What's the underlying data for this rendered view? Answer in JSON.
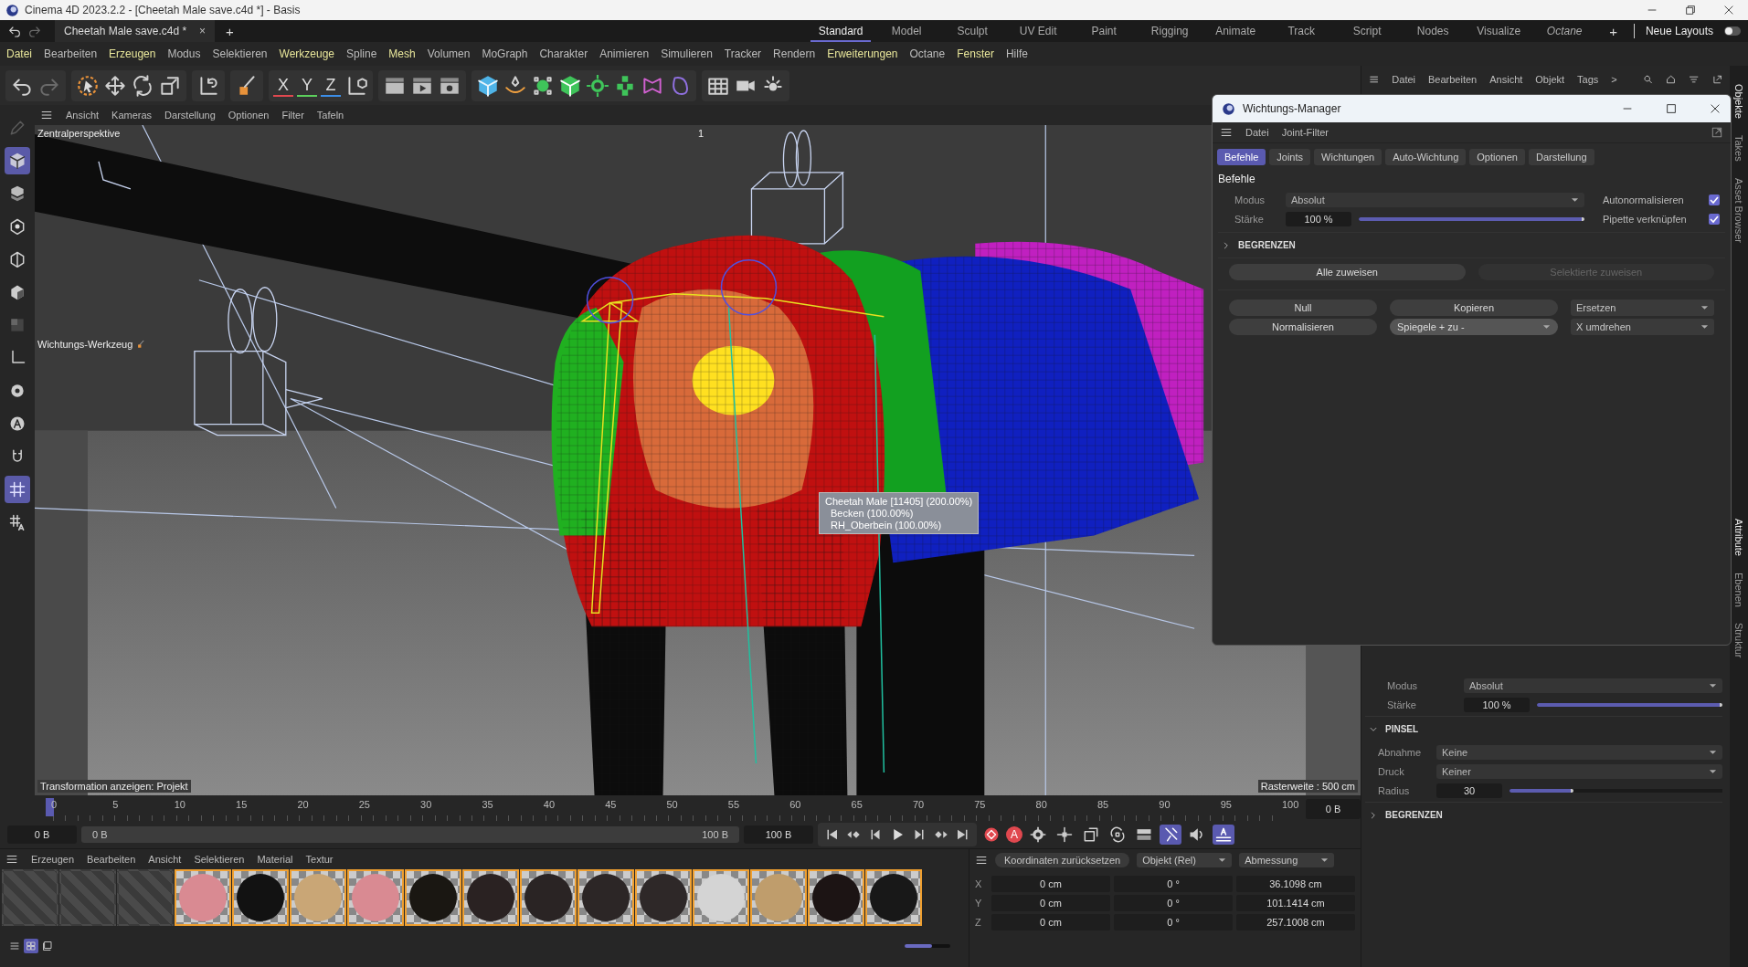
{
  "window": {
    "title": "Cinema 4D 2023.2.2 - [Cheetah Male save.c4d *] - Basis"
  },
  "document_tab": {
    "label": "Cheetah Male save.c4d *",
    "close": "×",
    "add": "+"
  },
  "layouts": [
    {
      "label": "Standard",
      "selected": true,
      "italic": false
    },
    {
      "label": "Model",
      "selected": false,
      "italic": false
    },
    {
      "label": "Sculpt",
      "selected": false,
      "italic": false
    },
    {
      "label": "UV Edit",
      "selected": false,
      "italic": false
    },
    {
      "label": "Paint",
      "selected": false,
      "italic": false
    },
    {
      "label": "Rigging",
      "selected": false,
      "italic": false
    },
    {
      "label": "Animate",
      "selected": false,
      "italic": false
    },
    {
      "label": "Track",
      "selected": false,
      "italic": false
    },
    {
      "label": "Script",
      "selected": false,
      "italic": false
    },
    {
      "label": "Nodes",
      "selected": false,
      "italic": false
    },
    {
      "label": "Visualize",
      "selected": false,
      "italic": false
    },
    {
      "label": "Octane",
      "selected": false,
      "italic": true
    }
  ],
  "layout_add": "+",
  "new_layouts": {
    "label": "Neue Layouts",
    "on": false
  },
  "menu": [
    {
      "label": "Datei",
      "highlight": true
    },
    {
      "label": "Bearbeiten",
      "highlight": false
    },
    {
      "label": "Erzeugen",
      "highlight": true
    },
    {
      "label": "Modus",
      "highlight": false
    },
    {
      "label": "Selektieren",
      "highlight": false
    },
    {
      "label": "Werkzeuge",
      "highlight": true
    },
    {
      "label": "Spline",
      "highlight": false
    },
    {
      "label": "Mesh",
      "highlight": true
    },
    {
      "label": "Volumen",
      "highlight": false
    },
    {
      "label": "MoGraph",
      "highlight": false
    },
    {
      "label": "Charakter",
      "highlight": false
    },
    {
      "label": "Animieren",
      "highlight": false
    },
    {
      "label": "Simulieren",
      "highlight": false
    },
    {
      "label": "Tracker",
      "highlight": false
    },
    {
      "label": "Rendern",
      "highlight": false
    },
    {
      "label": "Erweiterungen",
      "highlight": true
    },
    {
      "label": "Octane",
      "highlight": false
    },
    {
      "label": "Fenster",
      "highlight": true
    },
    {
      "label": "Hilfe",
      "highlight": false
    }
  ],
  "axes": [
    {
      "label": "X",
      "color": "#e0484f"
    },
    {
      "label": "Y",
      "color": "#5ccf5c"
    },
    {
      "label": "Z",
      "color": "#3c8ee8"
    }
  ],
  "left_tools": [
    {
      "selected": false
    },
    {
      "selected": true
    },
    {
      "selected": false
    },
    {
      "selected": false
    },
    {
      "selected": false
    },
    {
      "selected": false
    },
    {
      "selected": false
    },
    {
      "selected": false
    },
    {
      "selected": false
    },
    {
      "selected": false
    },
    {
      "selected": false
    },
    {
      "selected": true
    },
    {
      "selected": false
    }
  ],
  "viewport": {
    "menu": [
      "Ansicht",
      "Kameras",
      "Darstellung",
      "Optionen",
      "Filter",
      "Tafeln"
    ],
    "camera_label": "Zentralperspektive",
    "view_number": "1",
    "tool_label": "Wichtungs-Werkzeug",
    "transform_label": "Transformation anzeigen: Projekt",
    "grid_label": "Rasterweite : 500 cm",
    "tooltip": [
      "Cheetah Male [11405] (200.00%)",
      "Becken (100.00%)",
      "RH_Oberbein (100.00%)"
    ]
  },
  "object_manager": {
    "menu": [
      "Datei",
      "Bearbeiten",
      "Ansicht",
      "Objekt",
      "Tags"
    ],
    "more": ">"
  },
  "weight_manager": {
    "title": "Wichtungs-Manager",
    "menu": [
      "Datei",
      "Joint-Filter"
    ],
    "tabs": [
      {
        "label": "Befehle",
        "selected": true
      },
      {
        "label": "Joints",
        "selected": false
      },
      {
        "label": "Wichtungen",
        "selected": false
      },
      {
        "label": "Auto-Wichtung",
        "selected": false
      },
      {
        "label": "Optionen",
        "selected": false
      },
      {
        "label": "Darstellung",
        "selected": false
      }
    ],
    "section": "Befehle",
    "mode": {
      "label": "Modus",
      "value": "Absolut"
    },
    "strength": {
      "label": "Stärke",
      "value": "100 %",
      "level": 1
    },
    "options": [
      {
        "label": "Autonormalisieren",
        "checked": true
      },
      {
        "label": "Pipette verknüpfen",
        "checked": true
      }
    ],
    "limit": {
      "label": "BEGRENZEN",
      "expanded": false
    },
    "assign_buttons": [
      {
        "label": "Alle zuweisen",
        "disabled": false
      },
      {
        "label": "Selektierte zuweisen",
        "disabled": true
      }
    ],
    "commands": [
      {
        "kind": "button",
        "label": "Null"
      },
      {
        "kind": "button",
        "label": "Kopieren"
      },
      {
        "kind": "dropdown",
        "label": "Ersetzen"
      },
      {
        "kind": "button",
        "label": "Normalisieren"
      },
      {
        "kind": "split",
        "label": "Spiegele + zu -"
      },
      {
        "kind": "dropdown",
        "label": "X umdrehen"
      }
    ]
  },
  "attributes": {
    "mode": {
      "label": "Modus",
      "value": "Absolut"
    },
    "strength": {
      "label": "Stärke",
      "value": "100 %",
      "level": 1
    },
    "brush": {
      "label": "PINSEL",
      "expanded": true,
      "fields": [
        {
          "kind": "dropdown",
          "label": "Abnahme",
          "value": "Keine"
        },
        {
          "kind": "dropdown",
          "label": "Druck",
          "value": "Keiner"
        },
        {
          "kind": "slider",
          "label": "Radius",
          "value": "30",
          "level": 0.3
        }
      ]
    },
    "limit": {
      "label": "BEGRENZEN",
      "expanded": false
    }
  },
  "side_tabs_top": [
    {
      "label": "Objekte",
      "selected": true
    },
    {
      "label": "Takes",
      "selected": false
    },
    {
      "label": "Asset Browser",
      "selected": false
    }
  ],
  "side_tabs_bottom": [
    {
      "label": "Attribute",
      "selected": true
    },
    {
      "label": "Ebenen",
      "selected": false
    },
    {
      "label": "Struktur",
      "selected": false
    }
  ],
  "timeline": {
    "ticks": [
      "0",
      "5",
      "10",
      "15",
      "20",
      "25",
      "30",
      "35",
      "40",
      "45",
      "50",
      "55",
      "60",
      "65",
      "70",
      "75",
      "80",
      "85",
      "90",
      "95",
      "100"
    ],
    "current_frame": "0 B",
    "start": "0 B",
    "range_start": "0 B",
    "range_end": "100 B",
    "end": "100 B",
    "autokey_label": "A"
  },
  "key_toggles": [
    {
      "selected": false
    },
    {
      "selected": false
    },
    {
      "selected": false
    },
    {
      "selected": false
    },
    {
      "selected": false
    },
    {
      "selected": true
    },
    {
      "selected": false
    },
    {
      "selected": true
    }
  ],
  "materials": {
    "menu": [
      "Erzeugen",
      "Bearbeiten",
      "Ansicht",
      "Selektieren",
      "Material",
      "Textur"
    ],
    "items": [
      {
        "kind": "empty",
        "selected": false
      },
      {
        "kind": "empty",
        "selected": false
      },
      {
        "kind": "empty",
        "selected": false
      },
      {
        "kind": "sphere",
        "color": "#d98a92",
        "selected": true
      },
      {
        "kind": "sphere",
        "color": "#121212",
        "selected": true
      },
      {
        "kind": "sphere",
        "color": "#c9a676",
        "selected": true
      },
      {
        "kind": "sphere",
        "color": "#d98a92",
        "selected": true
      },
      {
        "kind": "sphere",
        "color": "#1a1712",
        "selected": true
      },
      {
        "kind": "sphere",
        "color": "#2a2222",
        "selected": true
      },
      {
        "kind": "sphere",
        "color": "#2a2424",
        "selected": true
      },
      {
        "kind": "sphere",
        "color": "#2c2626",
        "selected": true
      },
      {
        "kind": "sphere",
        "color": "#2e2828",
        "selected": true
      },
      {
        "kind": "sphere",
        "color": "#d4d4d4",
        "selected": true
      },
      {
        "kind": "sphere",
        "color": "#bf9d6c",
        "selected": true
      },
      {
        "kind": "sphere",
        "color": "#1c1414",
        "selected": true
      },
      {
        "kind": "sphere",
        "color": "#181818",
        "selected": true
      }
    ],
    "view_modes": [
      {
        "selected": false
      },
      {
        "selected": true
      },
      {
        "selected": false
      }
    ],
    "zoom_slider": {
      "level": 0.6
    }
  },
  "coordinates": {
    "reset": "Koordinaten zurücksetzen",
    "space": "Objekt (Rel)",
    "size_mode": "Abmessung",
    "rows": [
      {
        "axis": "X",
        "position": "0 cm",
        "rotation": "0 °",
        "size": "36.1098 cm"
      },
      {
        "axis": "Y",
        "position": "0 cm",
        "rotation": "0 °",
        "size": "101.1414 cm"
      },
      {
        "axis": "Z",
        "position": "0 cm",
        "rotation": "0 °",
        "size": "257.1008 cm"
      }
    ]
  }
}
